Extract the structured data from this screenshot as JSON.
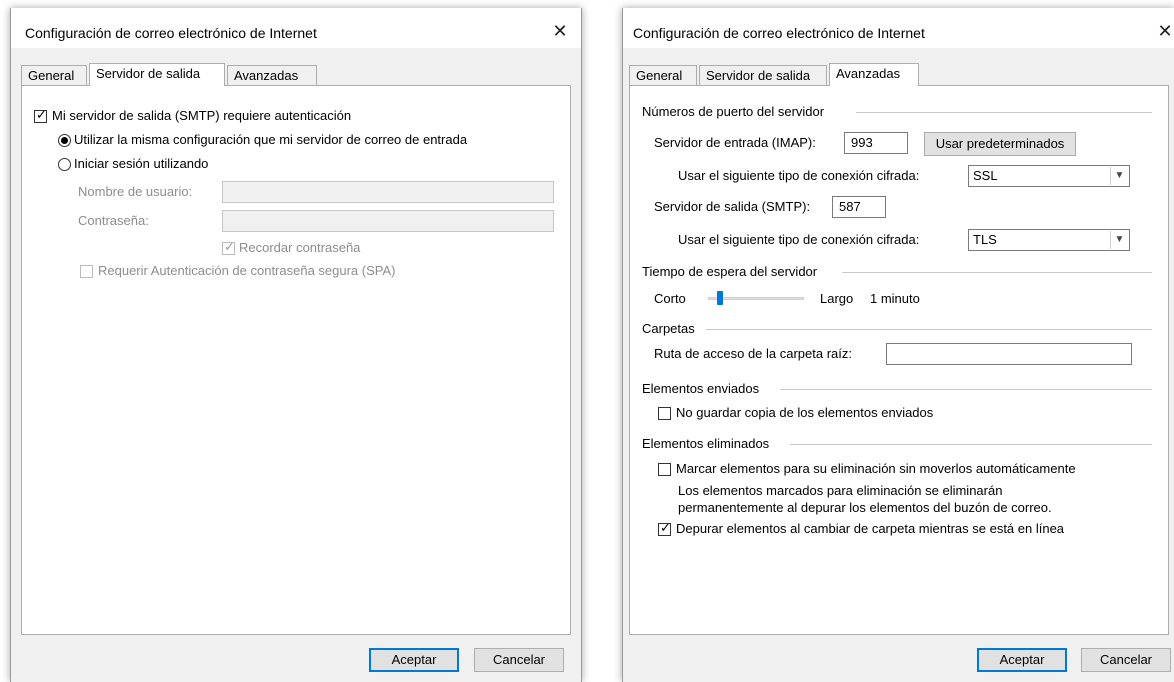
{
  "dialog_left": {
    "title": "Configuración de correo electrónico de Internet",
    "close": "✕",
    "tabs": [
      "General",
      "Servidor de salida",
      "Avanzadas"
    ],
    "smtp_auth": {
      "label": "Mi servidor de salida (SMTP) requiere autenticación",
      "checked": true
    },
    "radio_same": {
      "label": "Utilizar la misma configuración que mi servidor de correo de entrada",
      "selected": true
    },
    "radio_login": {
      "label": "Iniciar sesión utilizando",
      "selected": false
    },
    "username_label": "Nombre de usuario:",
    "username_value": "",
    "password_label": "Contraseña:",
    "password_value": "",
    "remember_password": {
      "label": "Recordar contraseña",
      "checked": true
    },
    "spa": {
      "label": "Requerir Autenticación de contraseña segura (SPA)",
      "checked": false
    },
    "ok": "Aceptar",
    "cancel": "Cancelar"
  },
  "dialog_right": {
    "title": "Configuración de correo electrónico de Internet",
    "close": "✕",
    "tabs": [
      "General",
      "Servidor de salida",
      "Avanzadas"
    ],
    "ports_group": "Números de puerto del servidor",
    "incoming_label": "Servidor de entrada (IMAP):",
    "incoming_port": "993",
    "use_defaults": "Usar predeterminados",
    "enc_label_1": "Usar el siguiente tipo de conexión cifrada:",
    "enc_value_1": "SSL",
    "outgoing_label": "Servidor de salida (SMTP):",
    "outgoing_port": "587",
    "enc_label_2": "Usar el siguiente tipo de conexión cifrada:",
    "enc_value_2": "TLS",
    "timeout_group": "Tiempo de espera del servidor",
    "timeout_short": "Corto",
    "timeout_long": "Largo",
    "timeout_value": "1 minuto",
    "timeout_level": 0.1,
    "folders_group": "Carpetas",
    "root_path_label": "Ruta de acceso de la carpeta raíz:",
    "root_path_value": "",
    "sent_group": "Elementos enviados",
    "no_save_sent": {
      "label": "No guardar copia de los elementos enviados",
      "checked": false
    },
    "deleted_group": "Elementos eliminados",
    "mark_deleted": {
      "label": "Marcar elementos para su eliminación sin moverlos automáticamente",
      "checked": false
    },
    "mark_deleted_note_1": "Los elementos marcados para eliminación se eliminarán",
    "mark_deleted_note_2": "permanentemente al depurar los elementos del buzón de correo.",
    "purge_on_switch": {
      "label": "Depurar elementos al cambiar de carpeta mientras se está en línea",
      "checked": true
    },
    "ok": "Aceptar",
    "cancel": "Cancelar"
  },
  "colors": {
    "dialog_bg": "#f0f0f0",
    "panel_bg": "#ffffff",
    "accent": "#0078d7",
    "disabled_text": "#8d8d8d"
  }
}
